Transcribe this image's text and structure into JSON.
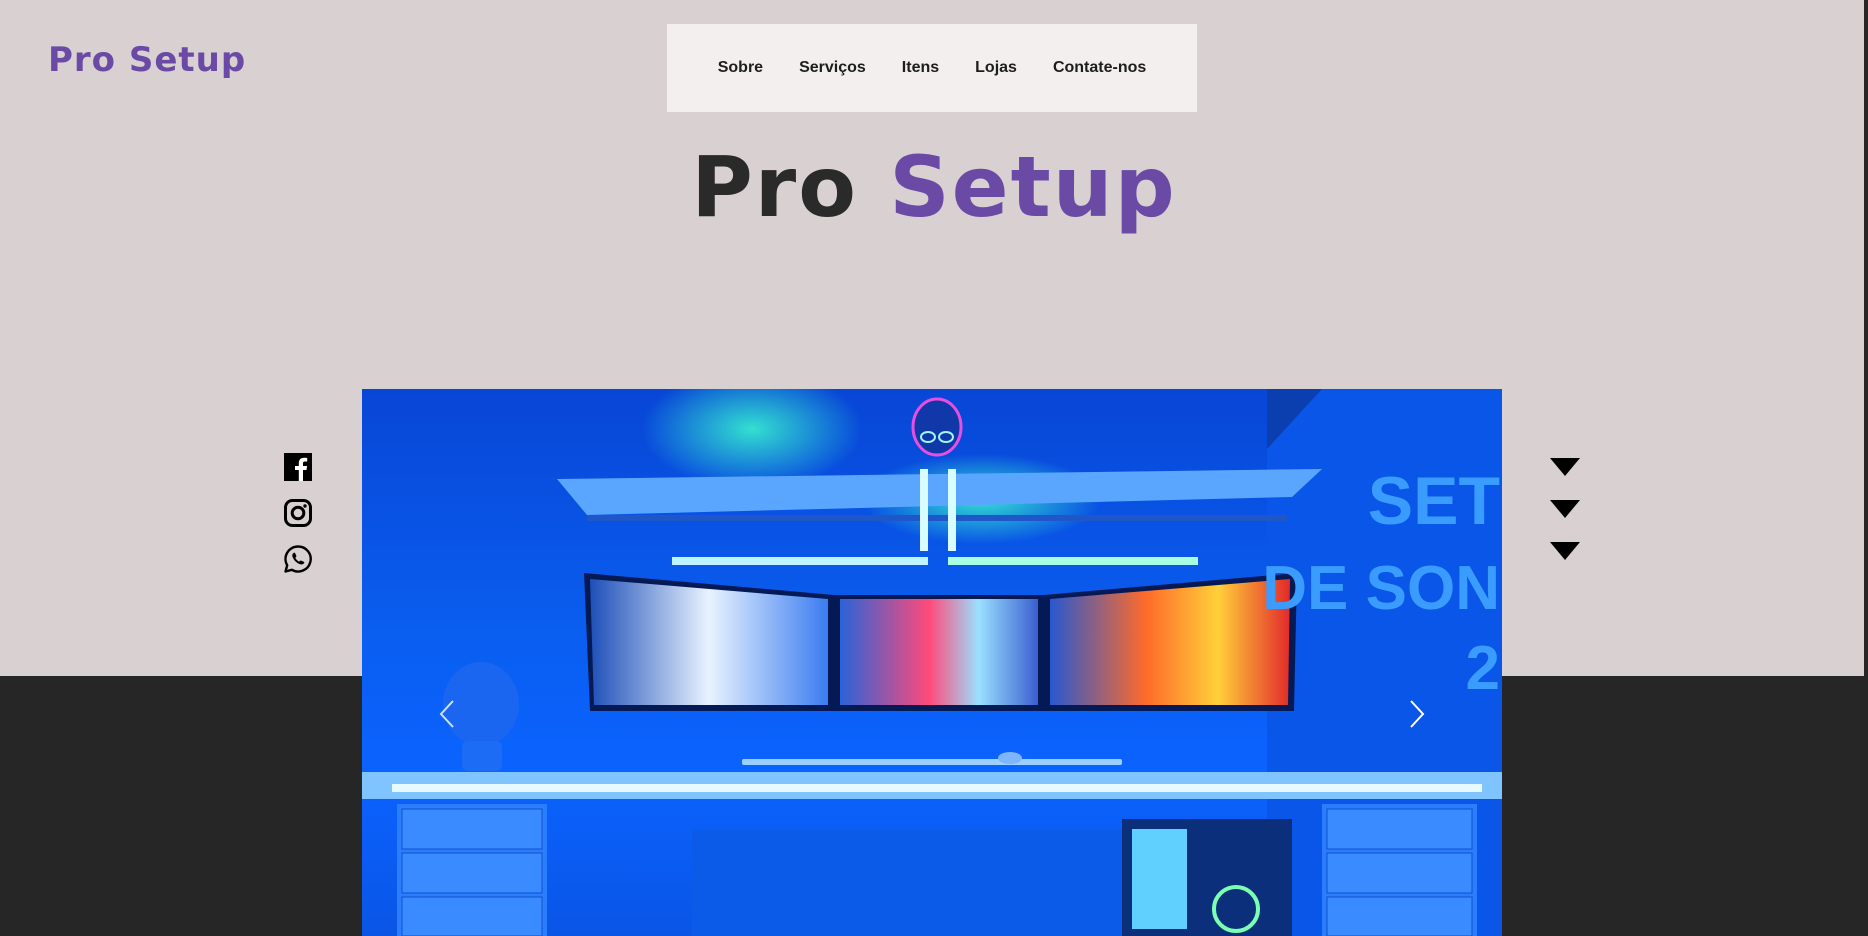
{
  "brand": {
    "logo": "Pro Setup"
  },
  "nav": {
    "items": [
      "Sobre",
      "Serviços",
      "Itens",
      "Lojas",
      "Contate-nos"
    ]
  },
  "hero": {
    "title_word1": "Pro",
    "title_word2": "Setup"
  },
  "social": {
    "icons": [
      "facebook-icon",
      "instagram-icon",
      "whatsapp-icon"
    ]
  },
  "wall_text": {
    "line1": "SET",
    "line2": "DE SON",
    "line3": "2"
  },
  "colors": {
    "accent": "#6b4aa6",
    "background": "#d9d1d1",
    "dark_band": "#262626",
    "nav_bg": "#f3efef"
  }
}
